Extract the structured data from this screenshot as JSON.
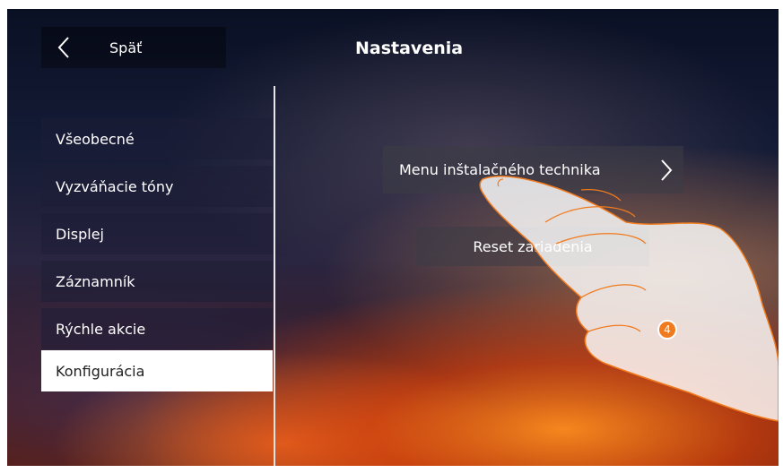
{
  "header": {
    "back_label": "Späť",
    "title": "Nastavenia"
  },
  "sidebar": {
    "items": [
      {
        "label": "Všeobecné"
      },
      {
        "label": "Vyzváňacie tóny"
      },
      {
        "label": "Displej"
      },
      {
        "label": "Záznamník"
      },
      {
        "label": "Rýchle akcie"
      },
      {
        "label": "Konfigurácia",
        "selected": true
      }
    ]
  },
  "main": {
    "installer_menu_label": "Menu inštalačného technika",
    "reset_label": "Reset zariadenia"
  },
  "step_badge": "4",
  "colors": {
    "accent": "#f07a1e",
    "selected_bg": "#ffffff"
  }
}
